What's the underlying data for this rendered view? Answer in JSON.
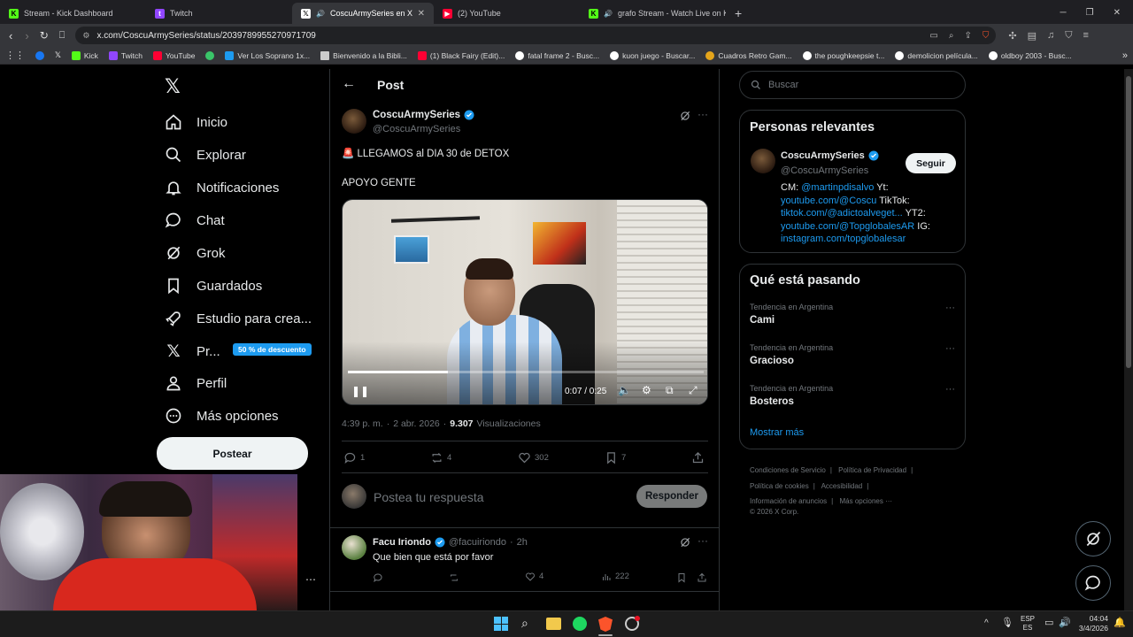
{
  "browser": {
    "tabs": [
      {
        "title": "Stream - Kick Dashboard",
        "color": "#53fc18"
      },
      {
        "title": "Twitch",
        "color": "#9146ff"
      },
      {
        "title": "CoscuArmySeries en X: \"🚨 LL",
        "color": "#ffffff",
        "active": true
      },
      {
        "title": "(2) YouTube",
        "color": "#ff0033"
      },
      {
        "title": "grafo Stream - Watch Live on Kick",
        "color": "#53fc18"
      }
    ],
    "url": "x.com/CoscuArmySeries/status/2039789955270971709",
    "bookmarks": [
      "Kick",
      "Twitch",
      "YouTube",
      "Ver Los Soprano 1x...",
      "Bienvenido a la Bibli...",
      "(1) Black Fairy (Edit)...",
      "fatal frame 2 - Busc...",
      "kuon juego - Buscar...",
      "Cuadros Retro Gam...",
      "the poughkeepsie t...",
      "demolicion película...",
      "oldboy 2003 - Busc..."
    ]
  },
  "sidebar": {
    "items": [
      {
        "label": "Inicio"
      },
      {
        "label": "Explorar"
      },
      {
        "label": "Notificaciones"
      },
      {
        "label": "Chat"
      },
      {
        "label": "Grok"
      },
      {
        "label": "Guardados"
      },
      {
        "label": "Estudio para crea..."
      },
      {
        "label": "Pr..."
      },
      {
        "label": "Perfil"
      },
      {
        "label": "Más opciones"
      }
    ],
    "premium_badge": "50 % de descuento",
    "post_button": "Postear"
  },
  "post": {
    "header": "Post",
    "author_name": "CoscuArmySeries",
    "author_handle": "@CoscuArmySeries",
    "text_line1": "🚨 LLEGAMOS al DIA 30 de DETOX",
    "text_line2": "APOYO GENTE",
    "video_time": "0:07 / 0:25",
    "video_progress": 0.28,
    "time": "4:39 p. m.",
    "date": "2 abr. 2026",
    "views_count": "9.307",
    "views_label": "Visualizaciones",
    "replies": "1",
    "reposts": "4",
    "likes": "302",
    "bookmarks": "7",
    "reply_placeholder": "Postea tu respuesta",
    "reply_button": "Responder"
  },
  "reply": {
    "name": "Facu Iriondo",
    "handle": "@facuiriondo",
    "time": "2h",
    "text": "Que bien que está por favor",
    "likes": "4",
    "views": "222"
  },
  "right": {
    "search_placeholder": "Buscar",
    "relevant_title": "Personas relevantes",
    "relevant": {
      "name": "CoscuArmySeries",
      "handle": "@CoscuArmySeries",
      "follow": "Seguir",
      "bio_cm": "CM:",
      "bio_link1": "@martinpdisalvo",
      "bio_yt": "Yt:",
      "bio_link2": "youtube.com/@Coscu",
      "bio_tiktok": "TikTok:",
      "bio_link3": "tiktok.com/@adictoalveget...",
      "bio_yt2": "YT2:",
      "bio_link4": "youtube.com/@TopglobalesAR",
      "bio_ig": "IG:",
      "bio_link5": "instagram.com/topglobalesar"
    },
    "trends_title": "Qué está pasando",
    "trends": [
      {
        "category": "Tendencia en Argentina",
        "name": "Cami"
      },
      {
        "category": "Tendencia en Argentina",
        "name": "Gracioso"
      },
      {
        "category": "Tendencia en Argentina",
        "name": "Bosteros"
      }
    ],
    "show_more": "Mostrar más",
    "footer": [
      "Condiciones de Servicio",
      "Política de Privacidad",
      "Política de cookies",
      "Accesibilidad",
      "Información de anuncios",
      "Más opciones ···",
      "© 2026 X Corp."
    ]
  },
  "taskbar": {
    "lang1": "ESP",
    "lang2": "ES",
    "time": "04:04",
    "date": "3/4/2026"
  },
  "colors": {
    "accent": "#1d9bf0",
    "background": "#000000",
    "border": "#2f3336"
  }
}
